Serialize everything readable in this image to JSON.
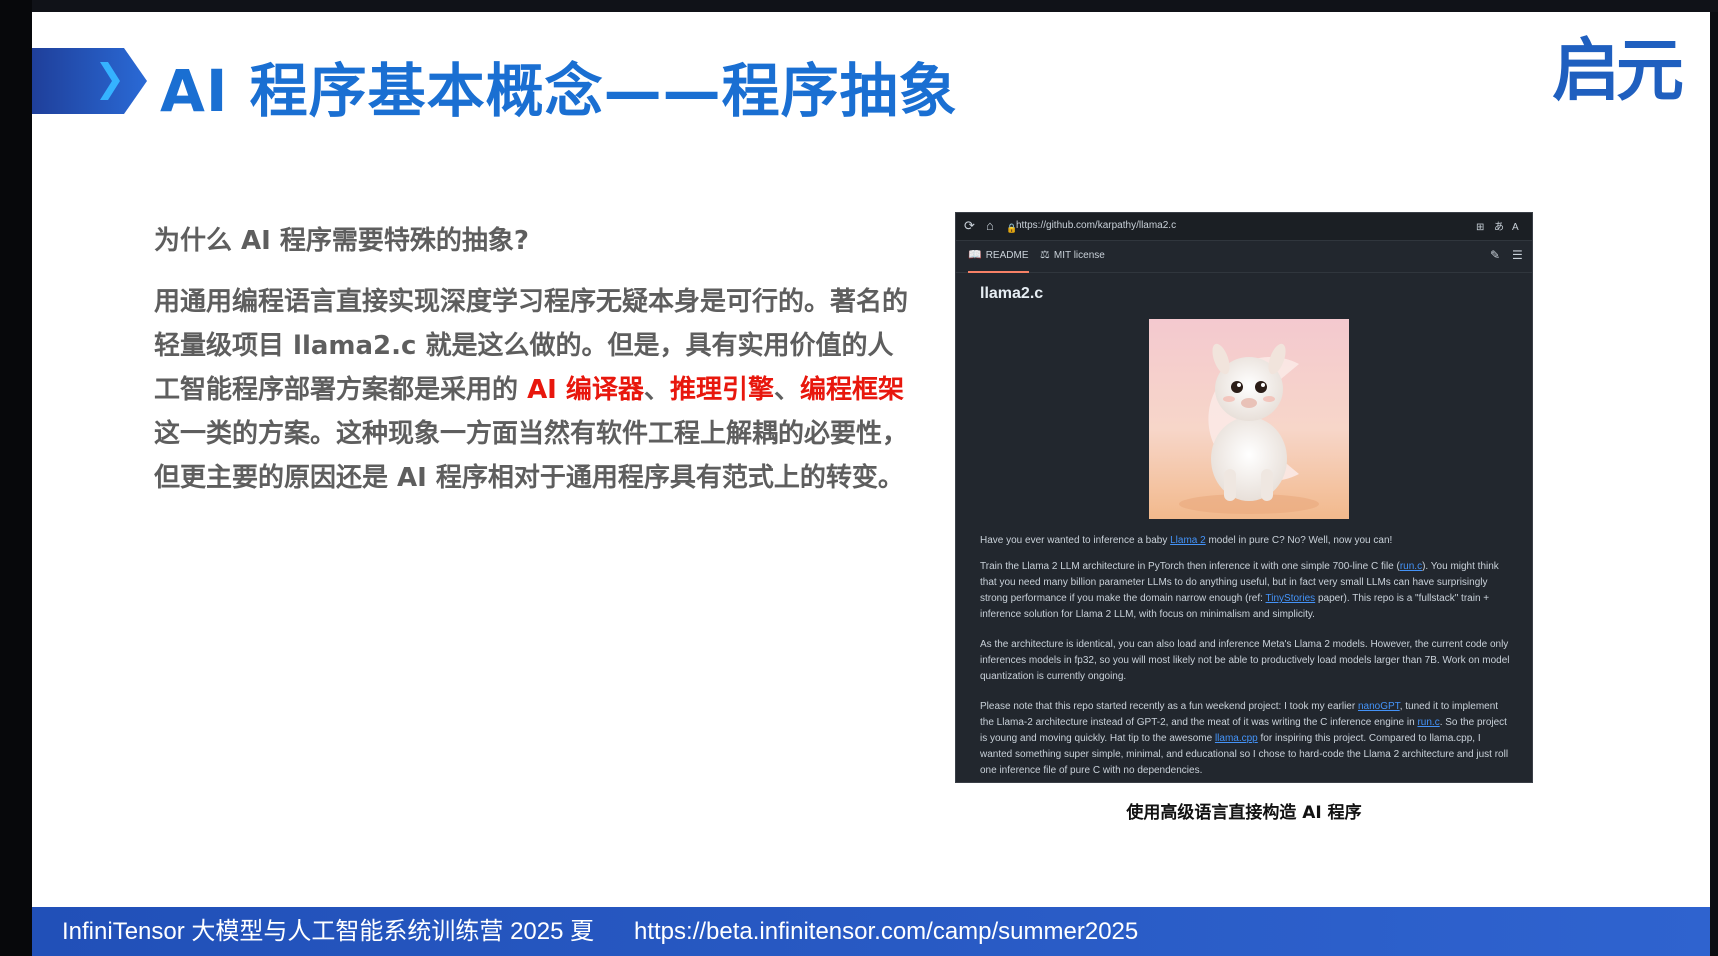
{
  "slide": {
    "title": "AI 程序基本概念——程序抽象",
    "logo_text": "启元",
    "question": "为什么 AI 程序需要特殊的抽象?",
    "body": {
      "p1": "用通用编程语言直接实现深度学习程序无疑本身是可行的。著名的轻量级项目 llama2.c 就是这么做的。但是，具有实用价值的人工智能程序部署方案都是采用的 ",
      "hl1": "AI 编译器",
      "sep1": "、",
      "hl2": "推理引擎",
      "sep2": "、",
      "hl3": "编程框架",
      "p2": "这一类的方案。这种现象一方面当然有软件工程上解耦的必要性，但更主要的原因还是 AI 程序相对于通用程序具有范式上的转变。"
    },
    "caption": "使用高级语言直接构造 AI 程序"
  },
  "browser": {
    "url": "https://github.com/karpathy/llama2.c",
    "tabs": [
      "README",
      "MIT license"
    ],
    "readme_title": "llama2.c",
    "p1": {
      "a": "Have you ever wanted to inference a baby ",
      "link": "Llama 2",
      "b": " model in pure C? No? Well, now you can!"
    },
    "p2": {
      "a": "Train the Llama 2 LLM architecture in PyTorch then inference it with one simple 700-line C file (",
      "link1": "run.c",
      "b": "). You might think that you need many billion parameter LLMs to do anything useful, but in fact very small LLMs can have surprisingly strong performance if you make the domain narrow enough (ref: ",
      "link2": "TinyStories",
      "c": " paper). This repo is a \"fullstack\" train + inference solution for Llama 2 LLM, with focus on minimalism and simplicity."
    },
    "p3": "As the architecture is identical, you can also load and inference Meta's Llama 2 models. However, the current code only inferences models in fp32, so you will most likely not be able to productively load models larger than 7B. Work on model quantization is currently ongoing.",
    "p4": {
      "a": "Please note that this repo started recently as a fun weekend project: I took my earlier ",
      "link1": "nanoGPT",
      "b": ", tuned it to implement the Llama-2 architecture instead of GPT-2, and the meat of it was writing the C inference engine in ",
      "link2": "run.c",
      "c": ". So the project is young and moving quickly. Hat tip to the awesome ",
      "link3": "llama.cpp",
      "d": " for inspiring this project. Compared to llama.cpp, I wanted something super simple, minimal, and educational so I chose to hard-code the Llama 2 architecture and just roll one inference file of pure C with no dependencies."
    }
  },
  "footer": {
    "left": "InfiniTensor 大模型与人工智能系统训练营 2025 夏",
    "url": "https://beta.infinitensor.com/camp/summer2025"
  },
  "colors": {
    "title": "#1a6fd2",
    "highlight": "#e8170d",
    "footer": "#2150b8",
    "text": "#5e5e5e"
  }
}
